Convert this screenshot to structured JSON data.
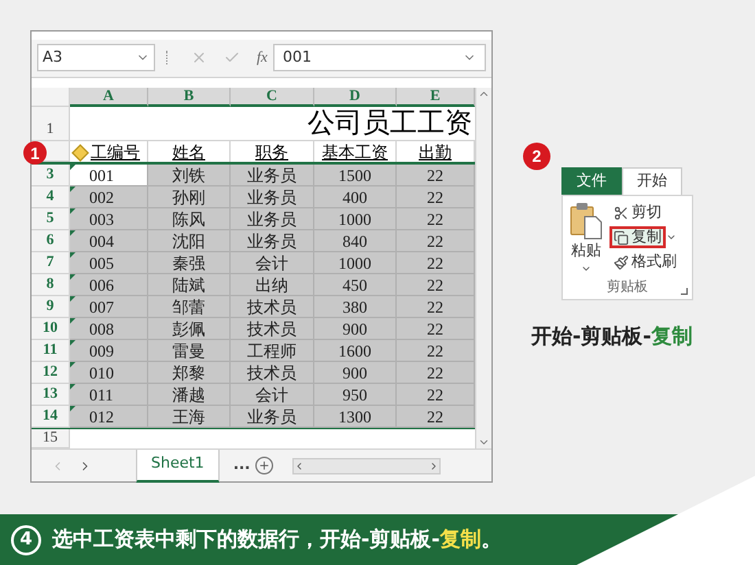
{
  "formula_bar": {
    "name_box": "A3",
    "function_label": "fx",
    "value": "001"
  },
  "sheet": {
    "badge": "1",
    "columns": [
      "A",
      "B",
      "C",
      "D",
      "E"
    ],
    "title_row_number": "1",
    "title": "公司员工工资",
    "headers": [
      "工编号",
      "姓名",
      "职务",
      "基本工资",
      "出勤"
    ],
    "rows": [
      {
        "number": "3",
        "cells": [
          "001",
          "刘铁",
          "业务员",
          "1500",
          "22"
        ],
        "selected": true,
        "active": true
      },
      {
        "number": "4",
        "cells": [
          "002",
          "孙刚",
          "业务员",
          "400",
          "22"
        ],
        "selected": true,
        "active": false
      },
      {
        "number": "5",
        "cells": [
          "003",
          "陈风",
          "业务员",
          "1000",
          "22"
        ],
        "selected": true,
        "active": false
      },
      {
        "number": "6",
        "cells": [
          "004",
          "沈阳",
          "业务员",
          "840",
          "22"
        ],
        "selected": true,
        "active": false
      },
      {
        "number": "7",
        "cells": [
          "005",
          "秦强",
          "会计",
          "1000",
          "22"
        ],
        "selected": true,
        "active": false
      },
      {
        "number": "8",
        "cells": [
          "006",
          "陆斌",
          "出纳",
          "450",
          "22"
        ],
        "selected": true,
        "active": false
      },
      {
        "number": "9",
        "cells": [
          "007",
          "邹蕾",
          "技术员",
          "380",
          "22"
        ],
        "selected": true,
        "active": false
      },
      {
        "number": "10",
        "cells": [
          "008",
          "彭佩",
          "技术员",
          "900",
          "22"
        ],
        "selected": true,
        "active": false
      },
      {
        "number": "11",
        "cells": [
          "009",
          "雷曼",
          "工程师",
          "1600",
          "22"
        ],
        "selected": true,
        "active": false
      },
      {
        "number": "12",
        "cells": [
          "010",
          "郑黎",
          "技术员",
          "900",
          "22"
        ],
        "selected": true,
        "active": false
      },
      {
        "number": "13",
        "cells": [
          "011",
          "潘越",
          "会计",
          "950",
          "22"
        ],
        "selected": true,
        "active": false
      },
      {
        "number": "14",
        "cells": [
          "012",
          "王海",
          "业务员",
          "1300",
          "22"
        ],
        "selected": true,
        "active": false
      }
    ],
    "empty_row_number": "15"
  },
  "sheet_tabs": {
    "tabs": [
      {
        "label": "Sheet1",
        "selected": true
      }
    ],
    "more": "..."
  },
  "ribbon": {
    "badge": "2",
    "tabs": [
      {
        "label": "文件",
        "kind": "file",
        "selected": false
      },
      {
        "label": "开始",
        "kind": "tab",
        "selected": true
      }
    ],
    "paste": "粘贴",
    "commands": [
      {
        "label": "剪切",
        "highlighted": false
      },
      {
        "label": "复制",
        "highlighted": true
      },
      {
        "label": "格式刷",
        "highlighted": false
      }
    ],
    "group": "剪贴板"
  },
  "caption": [
    {
      "text": "开始-剪贴板-",
      "highlight": false
    },
    {
      "text": "复制",
      "highlight": true
    }
  ],
  "instruction": {
    "number": "4",
    "parts": [
      {
        "text": "选中工资表中剩下的数据行，开始-剪贴板-",
        "highlight": false
      },
      {
        "text": "复制",
        "highlight": true
      },
      {
        "text": "。",
        "highlight": false
      }
    ]
  }
}
